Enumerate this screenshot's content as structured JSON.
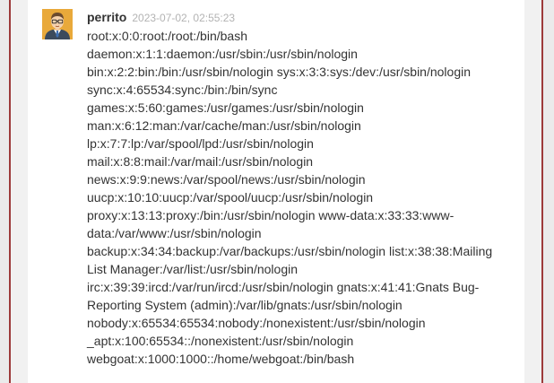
{
  "comment": {
    "author": "perrito",
    "timestamp": "2023-07-02, 02:55:23",
    "avatar_icon": "avatar-man-glasses-icon",
    "lines": [
      "root:x:0:0:root:/root:/bin/bash",
      "daemon:x:1:1:daemon:/usr/sbin:/usr/sbin/nologin",
      "bin:x:2:2:bin:/bin:/usr/sbin/nologin sys:x:3:3:sys:/dev:/usr/sbin/nologin",
      "sync:x:4:65534:sync:/bin:/bin/sync",
      "games:x:5:60:games:/usr/games:/usr/sbin/nologin",
      "man:x:6:12:man:/var/cache/man:/usr/sbin/nologin",
      "lp:x:7:7:lp:/var/spool/lpd:/usr/sbin/nologin",
      "mail:x:8:8:mail:/var/mail:/usr/sbin/nologin",
      "news:x:9:9:news:/var/spool/news:/usr/sbin/nologin",
      "uucp:x:10:10:uucp:/var/spool/uucp:/usr/sbin/nologin",
      "proxy:x:13:13:proxy:/bin:/usr/sbin/nologin www-data:x:33:33:www-",
      "data:/var/www:/usr/sbin/nologin",
      "backup:x:34:34:backup:/var/backups:/usr/sbin/nologin list:x:38:38:Mailing",
      "List Manager:/var/list:/usr/sbin/nologin",
      "irc:x:39:39:ircd:/var/run/ircd:/usr/sbin/nologin gnats:x:41:41:Gnats Bug-",
      "Reporting System (admin):/var/lib/gnats:/usr/sbin/nologin",
      "nobody:x:65534:65534:nobody:/nonexistent:/usr/sbin/nologin",
      "_apt:x:100:65534::/nonexistent:/usr/sbin/nologin",
      "webgoat:x:1000:1000::/home/webgoat:/bin/bash"
    ]
  }
}
